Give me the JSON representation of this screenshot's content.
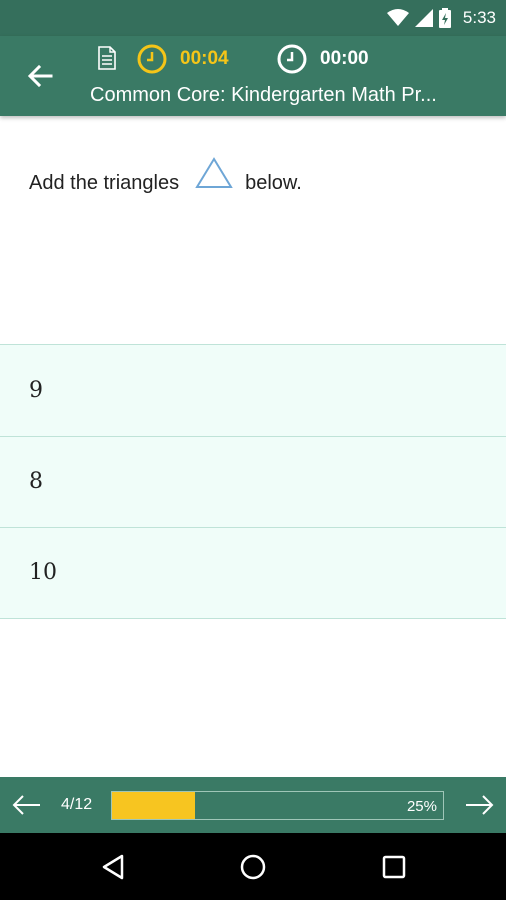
{
  "status_bar": {
    "time": "5:33",
    "icons": [
      "wifi-icon",
      "signal-icon",
      "battery-charging-icon"
    ]
  },
  "app_bar": {
    "timer_elapsed": "00:04",
    "timer_total": "00:00",
    "title": "Common Core: Kindergarten Math Pr...",
    "timer_elapsed_color": "#f5c518",
    "bar_color": "#3a7a65"
  },
  "question": {
    "text_before": "Add the triangles",
    "text_after": "below.",
    "shape": "triangle-outline"
  },
  "answers": [
    {
      "label": "9"
    },
    {
      "label": "8"
    },
    {
      "label": "10"
    }
  ],
  "footer": {
    "page": "4/12",
    "progress_label": "25%",
    "progress_value": 0.25,
    "progress_color": "#f7c520"
  },
  "nav_bar": {
    "icons": [
      "back-triangle-icon",
      "home-circle-icon",
      "recents-square-icon"
    ]
  }
}
